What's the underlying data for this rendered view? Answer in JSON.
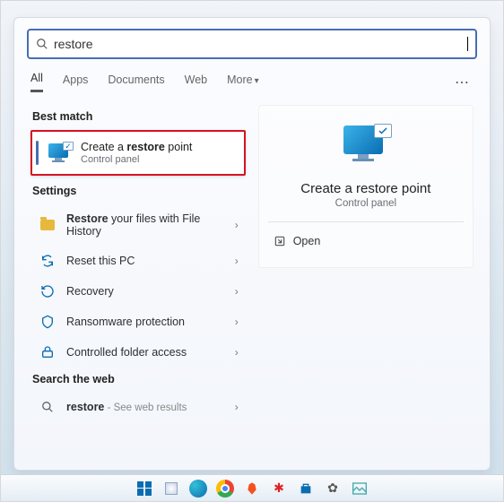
{
  "search": {
    "query": "restore"
  },
  "tabs": {
    "all": "All",
    "apps": "Apps",
    "documents": "Documents",
    "web": "Web",
    "more": "More"
  },
  "sections": {
    "best_match": "Best match",
    "settings": "Settings",
    "search_web": "Search the web"
  },
  "best_match": {
    "title_pre": "Create a ",
    "title_bold": "restore",
    "title_post": " point",
    "subtitle": "Control panel"
  },
  "settings_items": [
    {
      "id": "file-history",
      "pre": "",
      "bold": "Restore",
      "post": " your files with File History"
    },
    {
      "id": "reset-pc",
      "pre": "",
      "bold": "",
      "post": "Reset this PC"
    },
    {
      "id": "recovery",
      "pre": "",
      "bold": "",
      "post": "Recovery"
    },
    {
      "id": "ransomware",
      "pre": "",
      "bold": "",
      "post": "Ransomware protection"
    },
    {
      "id": "folder-access",
      "pre": "",
      "bold": "",
      "post": "Controlled folder access"
    }
  ],
  "web_item": {
    "bold": "restore",
    "dim": " - See web results"
  },
  "preview": {
    "title": "Create a restore point",
    "subtitle": "Control panel",
    "open": "Open"
  }
}
